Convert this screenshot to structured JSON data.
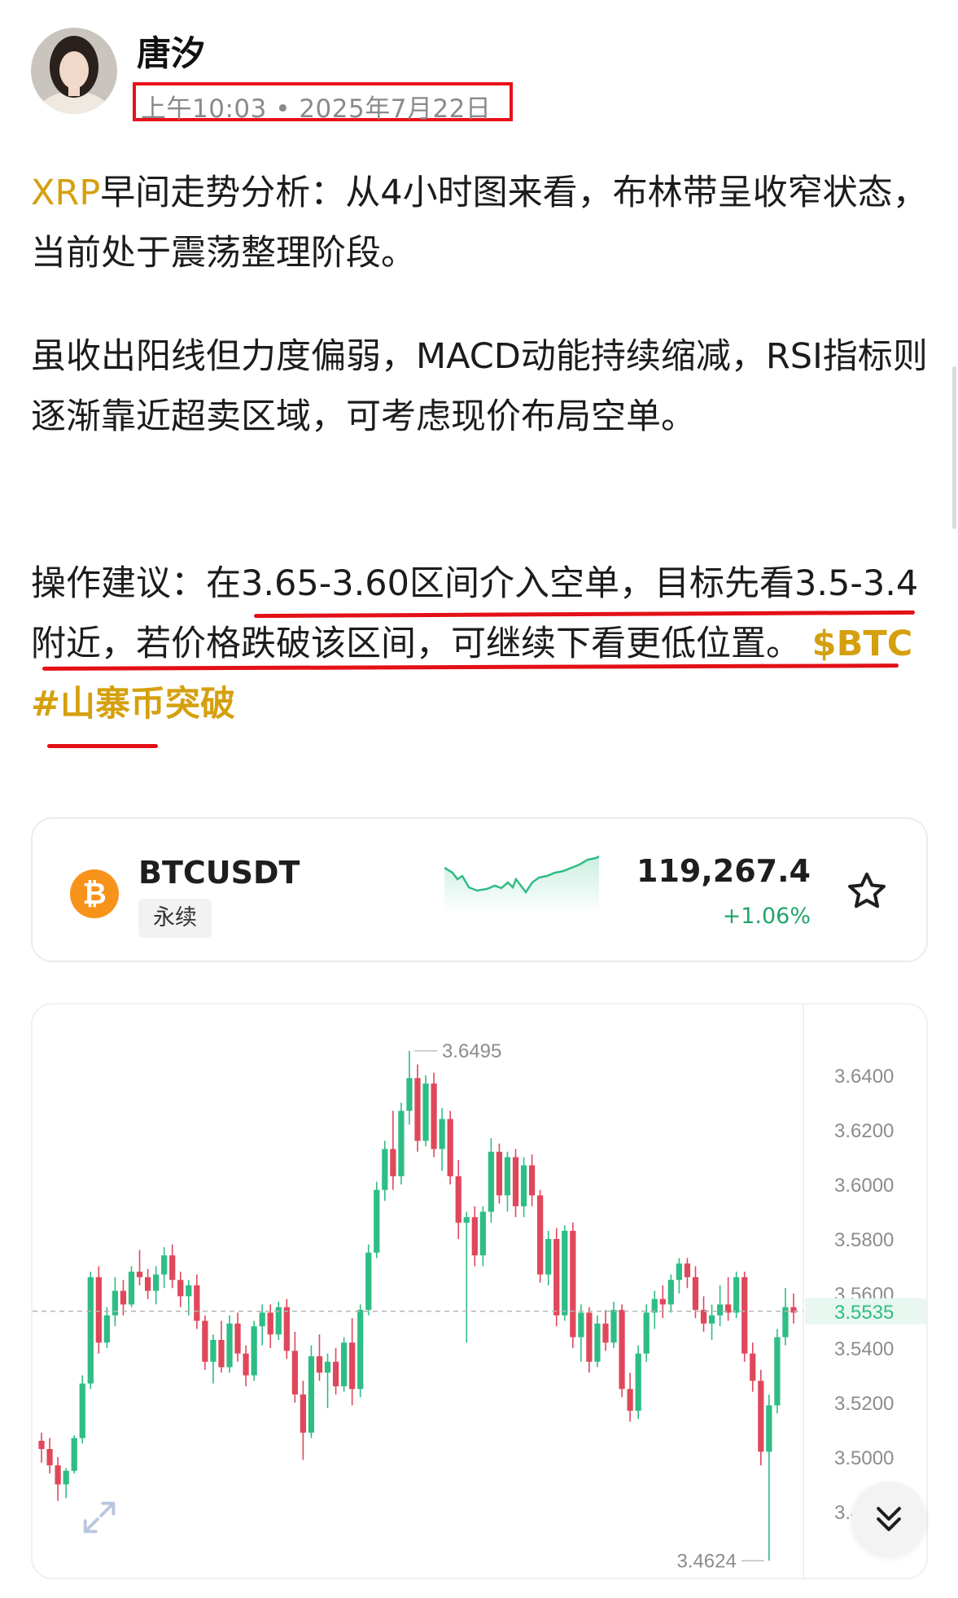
{
  "post": {
    "author": "唐汐",
    "time": "上午10:03 • 2025年7月22日",
    "p1_symbol": "XRP",
    "p1_text": "早间走势分析：从4小时图来看，布林带呈收窄状态，当前处于震荡整理阶段。",
    "p2_text": "虽收出阳线但力度偏弱，MACD动能持续缩减，RSI指标则逐渐靠近超卖区域，可考虑现价布局空单。",
    "p3_text": "操作建议：在3.65-3.60区间介入空单，目标先看3.5-3.4附近，若价格跌破该区间，可继续下看更低位置。",
    "p3_tag_cashtag": "$BTC",
    "p3_tag_hashtag": "#山寨币突破"
  },
  "ticker": {
    "symbol": "BTCUSDT",
    "type_tag": "永续",
    "price": "119,267.4",
    "change": "+1.06%",
    "coin_glyph": "₿",
    "icon": "bitcoin-icon",
    "up_color": "#22a56a"
  },
  "chart_data": {
    "type": "candlestick",
    "y_ticks": [
      "3.6400",
      "3.6200",
      "3.6000",
      "3.5800",
      "3.5600",
      "3.5400",
      "3.5200",
      "3.5000",
      "3.4800"
    ],
    "ylim": [
      3.46,
      3.66
    ],
    "current_price": "3.5535",
    "high_label": "3.6495",
    "low_label": "3.4624",
    "up_color": "#2ebd85",
    "down_color": "#e0475b",
    "candles": [
      [
        3.506,
        3.509,
        3.498,
        3.503
      ],
      [
        3.503,
        3.507,
        3.494,
        3.497
      ],
      [
        3.497,
        3.5,
        3.484,
        3.49
      ],
      [
        3.49,
        3.496,
        3.485,
        3.495
      ],
      [
        3.495,
        3.508,
        3.494,
        3.507
      ],
      [
        3.507,
        3.53,
        3.505,
        3.527
      ],
      [
        3.527,
        3.568,
        3.525,
        3.566
      ],
      [
        3.566,
        3.57,
        3.538,
        3.542
      ],
      [
        3.542,
        3.555,
        3.54,
        3.552
      ],
      [
        3.552,
        3.566,
        3.548,
        3.561
      ],
      [
        3.561,
        3.565,
        3.552,
        3.556
      ],
      [
        3.556,
        3.57,
        3.555,
        3.568
      ],
      [
        3.568,
        3.576,
        3.563,
        3.566
      ],
      [
        3.566,
        3.569,
        3.558,
        3.561
      ],
      [
        3.561,
        3.57,
        3.556,
        3.567
      ],
      [
        3.567,
        3.577,
        3.562,
        3.574
      ],
      [
        3.574,
        3.578,
        3.562,
        3.565
      ],
      [
        3.565,
        3.568,
        3.555,
        3.559
      ],
      [
        3.559,
        3.565,
        3.552,
        3.563
      ],
      [
        3.563,
        3.567,
        3.547,
        3.55
      ],
      [
        3.55,
        3.552,
        3.532,
        3.535
      ],
      [
        3.535,
        3.545,
        3.527,
        3.543
      ],
      [
        3.543,
        3.55,
        3.531,
        3.533
      ],
      [
        3.533,
        3.552,
        3.531,
        3.549
      ],
      [
        3.549,
        3.553,
        3.535,
        3.538
      ],
      [
        3.538,
        3.541,
        3.526,
        3.53
      ],
      [
        3.53,
        3.55,
        3.528,
        3.548
      ],
      [
        3.548,
        3.556,
        3.541,
        3.553
      ],
      [
        3.553,
        3.556,
        3.54,
        3.545
      ],
      [
        3.545,
        3.557,
        3.543,
        3.555
      ],
      [
        3.555,
        3.558,
        3.536,
        3.539
      ],
      [
        3.539,
        3.546,
        3.52,
        3.523
      ],
      [
        3.523,
        3.528,
        3.499,
        3.509
      ],
      [
        3.509,
        3.541,
        3.507,
        3.537
      ],
      [
        3.537,
        3.545,
        3.528,
        3.531
      ],
      [
        3.531,
        3.538,
        3.518,
        3.535
      ],
      [
        3.535,
        3.54,
        3.523,
        3.526
      ],
      [
        3.526,
        3.544,
        3.524,
        3.542
      ],
      [
        3.542,
        3.551,
        3.519,
        3.525
      ],
      [
        3.525,
        3.556,
        3.522,
        3.554
      ],
      [
        3.554,
        3.578,
        3.552,
        3.575
      ],
      [
        3.575,
        3.601,
        3.573,
        3.598
      ],
      [
        3.598,
        3.616,
        3.594,
        3.613
      ],
      [
        3.613,
        3.627,
        3.598,
        3.603
      ],
      [
        3.603,
        3.63,
        3.6,
        3.627
      ],
      [
        3.627,
        3.649,
        3.622,
        3.639
      ],
      [
        3.639,
        3.644,
        3.612,
        3.616
      ],
      [
        3.616,
        3.64,
        3.614,
        3.637
      ],
      [
        3.637,
        3.641,
        3.61,
        3.613
      ],
      [
        3.613,
        3.628,
        3.605,
        3.624
      ],
      [
        3.624,
        3.627,
        3.6,
        3.603
      ],
      [
        3.603,
        3.609,
        3.58,
        3.586
      ],
      [
        3.586,
        3.59,
        3.542,
        3.588
      ],
      [
        3.588,
        3.592,
        3.57,
        3.574
      ],
      [
        3.574,
        3.592,
        3.57,
        3.59
      ],
      [
        3.59,
        3.617,
        3.586,
        3.612
      ],
      [
        3.612,
        3.615,
        3.593,
        3.596
      ],
      [
        3.596,
        3.612,
        3.59,
        3.61
      ],
      [
        3.61,
        3.613,
        3.588,
        3.592
      ],
      [
        3.592,
        3.61,
        3.588,
        3.607
      ],
      [
        3.607,
        3.611,
        3.592,
        3.596
      ],
      [
        3.596,
        3.598,
        3.564,
        3.567
      ],
      [
        3.567,
        3.583,
        3.563,
        3.58
      ],
      [
        3.58,
        3.584,
        3.548,
        3.552
      ],
      [
        3.552,
        3.585,
        3.55,
        3.583
      ],
      [
        3.583,
        3.586,
        3.54,
        3.544
      ],
      [
        3.544,
        3.556,
        3.535,
        3.553
      ],
      [
        3.553,
        3.555,
        3.531,
        3.535
      ],
      [
        3.535,
        3.552,
        3.533,
        3.549
      ],
      [
        3.549,
        3.554,
        3.539,
        3.542
      ],
      [
        3.542,
        3.557,
        3.54,
        3.554
      ],
      [
        3.554,
        3.556,
        3.522,
        3.525
      ],
      [
        3.525,
        3.531,
        3.513,
        3.517
      ],
      [
        3.517,
        3.541,
        3.514,
        3.538
      ],
      [
        3.538,
        3.556,
        3.535,
        3.553
      ],
      [
        3.553,
        3.561,
        3.547,
        3.558
      ],
      [
        3.558,
        3.563,
        3.551,
        3.556
      ],
      [
        3.556,
        3.567,
        3.553,
        3.565
      ],
      [
        3.565,
        3.573,
        3.56,
        3.571
      ],
      [
        3.571,
        3.573,
        3.562,
        3.566
      ],
      [
        3.566,
        3.57,
        3.551,
        3.554
      ],
      [
        3.554,
        3.559,
        3.546,
        3.549
      ],
      [
        3.549,
        3.556,
        3.543,
        3.552
      ],
      [
        3.552,
        3.563,
        3.548,
        3.556
      ],
      [
        3.556,
        3.566,
        3.55,
        3.553
      ],
      [
        3.553,
        3.568,
        3.551,
        3.566
      ],
      [
        3.566,
        3.568,
        3.535,
        3.538
      ],
      [
        3.538,
        3.542,
        3.524,
        3.528
      ],
      [
        3.528,
        3.532,
        3.497,
        3.502
      ],
      [
        3.502,
        3.523,
        3.462,
        3.519
      ],
      [
        3.519,
        3.547,
        3.516,
        3.544
      ],
      [
        3.544,
        3.562,
        3.541,
        3.555
      ],
      [
        3.555,
        3.56,
        3.549,
        3.553
      ]
    ]
  },
  "ui": {
    "expand_icon": "expand-icon",
    "scroll_down_icon": "double-chevron-down-icon"
  }
}
